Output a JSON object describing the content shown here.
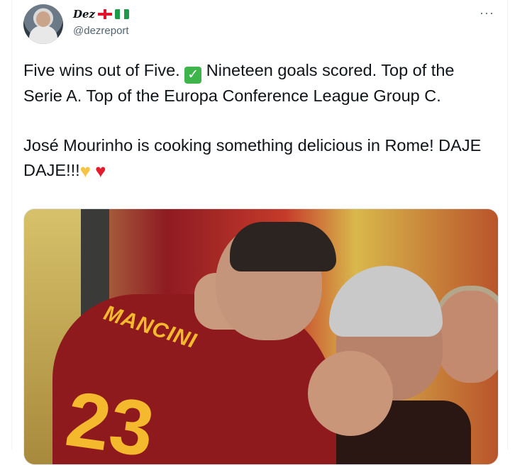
{
  "author": {
    "display_name": "Dez",
    "handle": "@dezreport",
    "flags": [
      "england-flag-icon",
      "nigeria-flag-icon"
    ]
  },
  "menu": {
    "more_label": "···"
  },
  "tweet": {
    "line1_a": "Five wins out of Five.",
    "line1_b": "Nineteen goals scored. Top of the Serie A. Top of the Europa Conference League Group C.",
    "line2": "José Mourinho is cooking something delicious in Rome! DAJE DAJE!!!",
    "emoji_check": "✓",
    "emoji_yellow_heart": "♥",
    "emoji_red_heart": "♥"
  },
  "media": {
    "shirt_name": "MANCINI",
    "shirt_number": "23"
  },
  "colors": {
    "text": "#0f1419",
    "secondary": "#536471",
    "roma_red": "#8f1a1e",
    "roma_gold": "#f5b92e"
  }
}
